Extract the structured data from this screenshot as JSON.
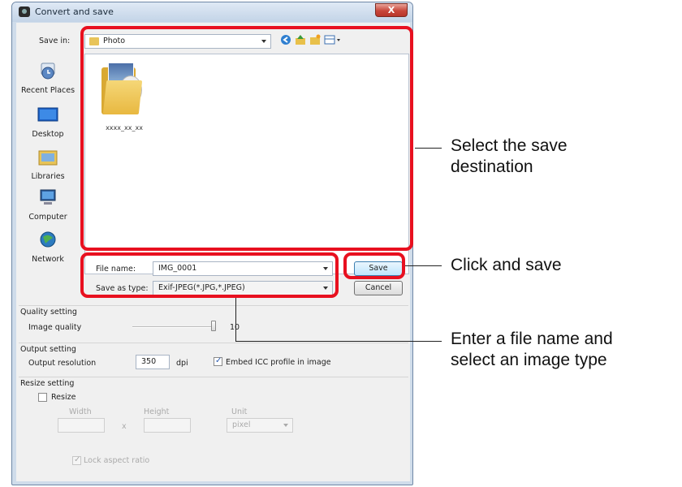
{
  "window": {
    "title": "Convert and save",
    "close_glyph": "X"
  },
  "dialog": {
    "save_in_label": "Save in:",
    "save_in_value": "Photo",
    "toolbar_icons": [
      "back-icon",
      "up-folder-icon",
      "new-folder-icon",
      "view-menu-icon"
    ],
    "places": [
      {
        "label": "Recent Places",
        "icon": "recent-places-icon"
      },
      {
        "label": "Desktop",
        "icon": "desktop-icon"
      },
      {
        "label": "Libraries",
        "icon": "libraries-icon"
      },
      {
        "label": "Computer",
        "icon": "computer-icon"
      },
      {
        "label": "Network",
        "icon": "network-icon"
      }
    ],
    "files": [
      {
        "name": "xxxx_xx_xx",
        "type": "folder"
      }
    ],
    "file_name_label": "File name:",
    "file_name_value": "IMG_0001",
    "save_type_label": "Save as type:",
    "save_type_value": "Exif-JPEG(*.JPG,*.JPEG)",
    "save_button": "Save",
    "cancel_button": "Cancel"
  },
  "quality": {
    "title": "Quality setting",
    "label": "Image quality",
    "value": "10",
    "slider_fraction": 1.0
  },
  "output": {
    "title": "Output setting",
    "label": "Output resolution",
    "value": "350",
    "unit": "dpi",
    "embed_icc_label": "Embed ICC profile in image",
    "embed_icc_checked": true
  },
  "resize": {
    "title": "Resize setting",
    "resize_label": "Resize",
    "resize_checked": false,
    "width_label": "Width",
    "height_label": "Height",
    "unit_label": "Unit",
    "times": "x",
    "unit_value": "pixel",
    "lock_label": "Lock aspect ratio",
    "lock_checked": true
  },
  "annotations": {
    "highlight_color": "#e8101f",
    "callouts": [
      {
        "line1": "Select the save",
        "line2": "destination"
      },
      {
        "line1": "Click and save",
        "line2": ""
      },
      {
        "line1": "Enter a file name and",
        "line2": "select an image type"
      }
    ]
  }
}
